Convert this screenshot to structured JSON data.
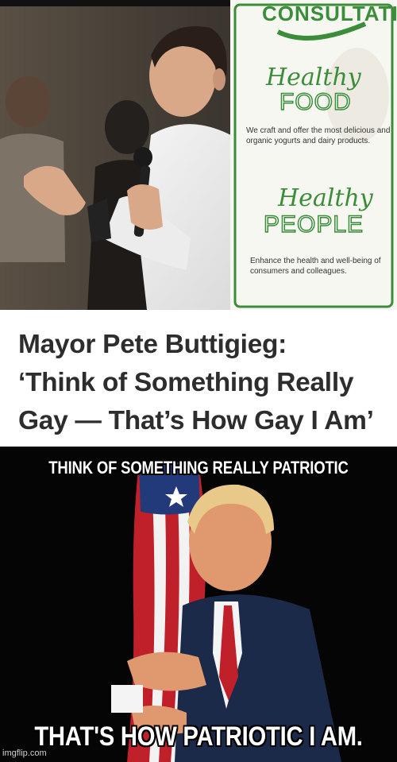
{
  "top_photo": {
    "sign": {
      "banner": "CONSULTATION",
      "heading_1": "Healthy",
      "heading_2": "FOOD",
      "text_1": "We craft and offer the most delicious and organic yogurts and dairy products.",
      "heading_3": "Healthy",
      "heading_4": "PEOPLE",
      "text_2": "Enhance the health and well-being of consumers and colleagues."
    }
  },
  "headline": {
    "line_1": "Mayor Pete Buttigieg:",
    "line_2": "‘Think of Something Really",
    "line_3": "Gay — That’s How Gay I Am’"
  },
  "bottom_photo": {
    "caption_top": "THINK OF SOMETHING REALLY PATRIOTIC",
    "caption_bottom": "THAT'S HOW PATRIOTIC I AM."
  },
  "watermark": "imgflip.com",
  "colors": {
    "headline_text": "#2d2d2d",
    "sign_green": "#3b8d3a",
    "caption_text": "#ffffff"
  }
}
